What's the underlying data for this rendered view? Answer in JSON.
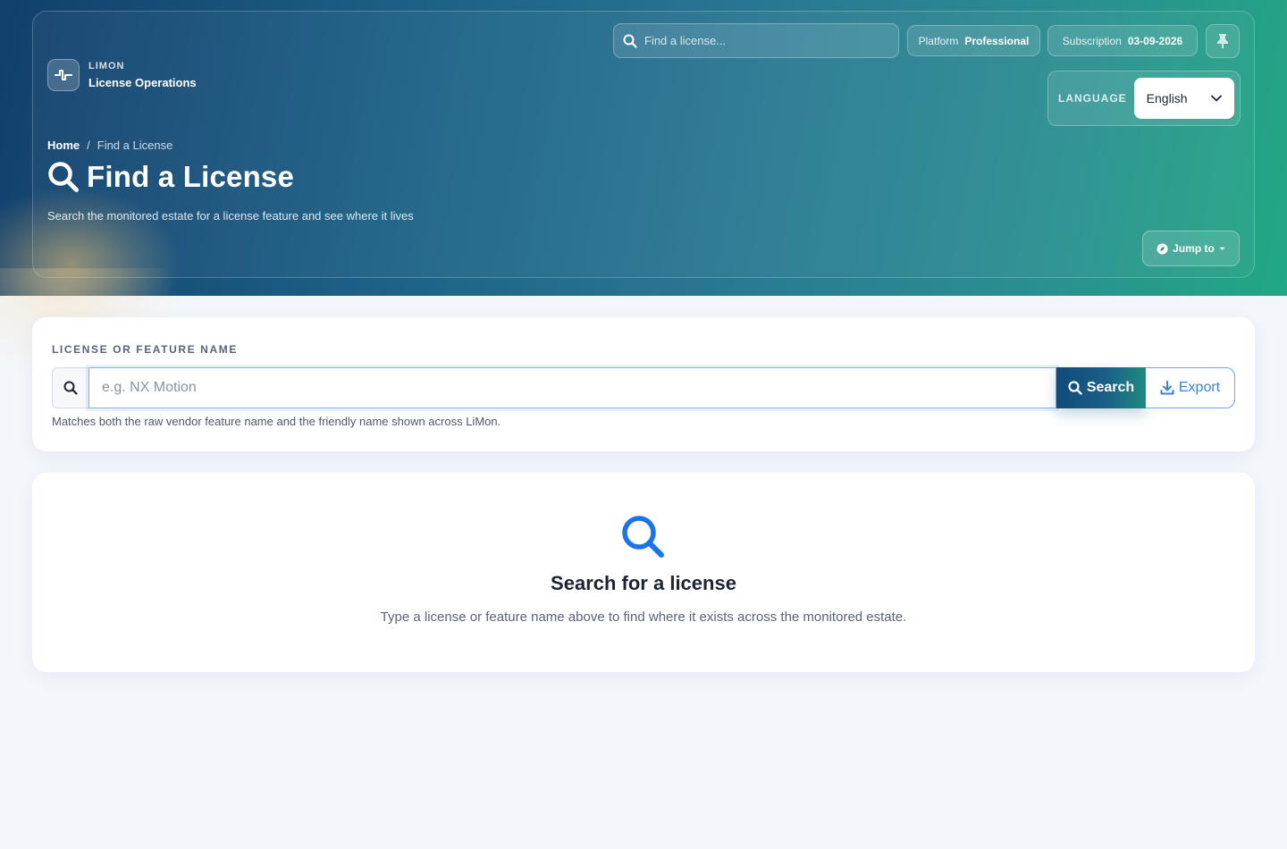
{
  "brand": {
    "eyebrow": "LIMON",
    "app_name": "License Operations"
  },
  "top_search": {
    "placeholder": "Find a license..."
  },
  "platform": {
    "label": "Platform",
    "value": "Professional"
  },
  "subscription": {
    "label": "Subscription",
    "value": "03-09-2026"
  },
  "language": {
    "label": "LANGUAGE",
    "selected": "English"
  },
  "breadcrumb": {
    "home": "Home",
    "separator": "/",
    "current": "Find a License"
  },
  "page": {
    "title": "Find a License",
    "subtitle": "Search the monitored estate for a license feature and see where it lives"
  },
  "jump_to": {
    "label": "Jump to"
  },
  "search_card": {
    "field_label": "LICENSE OR FEATURE NAME",
    "placeholder": "e.g. NX Motion",
    "value": "",
    "search_label": "Search",
    "export_label": "Export",
    "help_text": "Matches both the raw vendor feature name and the friendly name shown across LiMon."
  },
  "empty_state": {
    "title": "Search for a license",
    "text": "Type a license or feature name above to find where it exists across the monitored estate."
  },
  "icons": {
    "brand": "pulse-icon",
    "top_search": "search-icon",
    "pin": "pin-icon",
    "language_chevron": "chevron-down-icon",
    "title": "search-icon",
    "jump": "compass-icon",
    "input": "search-icon",
    "search_button": "search-icon",
    "export_button": "download-icon",
    "empty_state": "search-icon"
  },
  "colors": {
    "hero_start": "#123f6c",
    "hero_end": "#22a883",
    "accent": "#3b82d6",
    "empty_icon": "#1a73e8",
    "page_bg": "#f3f6fb"
  }
}
